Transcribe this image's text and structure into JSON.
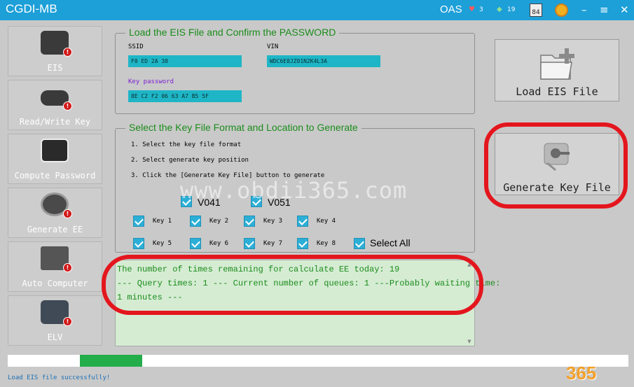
{
  "titlebar": {
    "title": "CGDI-MB",
    "oas": "OAS",
    "heart_count": "3",
    "gem_count": "19",
    "calendar_day": "84",
    "minimize": "–",
    "maximize": "≡",
    "close": "✕"
  },
  "sidebar": {
    "items": [
      {
        "label": "EIS",
        "icon": "ignition-lock-icon"
      },
      {
        "label": "Read/Write Key",
        "icon": "car-key-icon"
      },
      {
        "label": "Compute Password",
        "icon": "keypad-icon"
      },
      {
        "label": "Generate EE",
        "icon": "programmer-icon"
      },
      {
        "label": "Auto Computer",
        "icon": "ecu-icon"
      },
      {
        "label": "ELV",
        "icon": "steering-lock-icon"
      }
    ]
  },
  "eis_group": {
    "title": "Load the EIS File and Confirm the PASSWORD",
    "ssid_label": "SSID",
    "ssid_value": "F0 ED 2A 38",
    "vin_label": "VIN",
    "vin_value": "WDC6E8JZ01N2K4L3A",
    "key_password_label": "Key password",
    "key_password_value": "8E C2 F2 06 63 A7 B5 5F"
  },
  "key_group": {
    "title": "Select the Key File Format and Location to Generate",
    "steps": [
      "1. Select the key file format",
      "2. Select generate key position",
      "3. Click the [Generate Key File] button to generate"
    ],
    "formats": [
      "V041",
      "V051"
    ],
    "keys": [
      "Key 1",
      "Key 2",
      "Key 3",
      "Key 4",
      "Key 5",
      "Key 6",
      "Key 7",
      "Key 8"
    ],
    "select_all": "Select All"
  },
  "log": {
    "lines": [
      "The number of times remaining for calculate EE today: 19",
      "--- Query times: 1 --- Current number of queues: 1 ---Probably waiting time:",
      " 1 minutes ---"
    ]
  },
  "buttons": {
    "load_eis": "Load EIS File",
    "generate_key": "Generate Key File"
  },
  "progress": {
    "fraction_start": 0.116,
    "fraction_end": 0.217
  },
  "status": "Load EIS file successfully!",
  "watermark": "www.obdii365.com",
  "corner_logo": "365",
  "colors": {
    "titlebar": "#1d9fd8",
    "group_title": "#1b8c1b",
    "field_bg": "#1eb6c6",
    "progress": "#23ad4b",
    "annotation": "#e4161d"
  }
}
